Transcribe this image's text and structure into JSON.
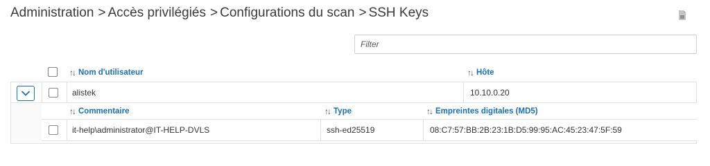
{
  "breadcrumb": {
    "items": [
      "Administration",
      "Accès privilégiés",
      "Configurations du scan",
      "SSH Keys"
    ],
    "separator": ">"
  },
  "toolbar": {
    "export_icon": "export-icon"
  },
  "filter": {
    "placeholder": "Filter",
    "value": ""
  },
  "grid": {
    "sort_icon": "↑↓",
    "columns": [
      "Nom d'utilisateur",
      "Hôte"
    ],
    "rows": [
      {
        "username": "alistek",
        "host": "10.10.0.20",
        "expanded": true,
        "detail": {
          "columns": [
            "Commentaire",
            "Type",
            "Empreintes digitales (MD5)"
          ],
          "rows": [
            {
              "comment": "it-help\\administrator@IT-HELP-DVLS",
              "type": "ssh-ed25519",
              "fingerprint": "08:C7:57:BB:2B:23:1B:D5:99:95:AC:45:23:47:5F:59"
            }
          ]
        }
      }
    ]
  },
  "colors": {
    "link": "#1b6fb6",
    "border": "#e2e2e2",
    "text": "#333333"
  }
}
